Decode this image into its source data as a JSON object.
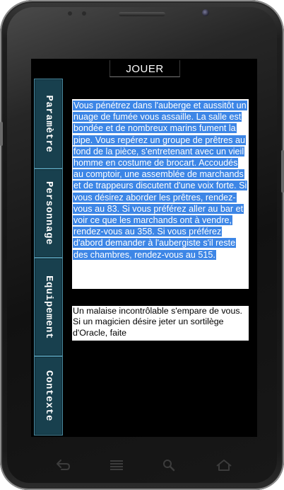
{
  "app": {
    "title": "JOUER"
  },
  "tabs": [
    {
      "label": "Paramètre"
    },
    {
      "label": "Personnage"
    },
    {
      "label": "Equipement"
    },
    {
      "label": "Contexte"
    }
  ],
  "story": {
    "text": "Vous pénétrez dans l'auberge et aussitôt un nuage de fumée vous assaille. La salle est bondée et de nombreux marins fument la pipe. Vous repérez un groupe de prêtres au fond de la pièce, s'entretenant avec un vieil homme en costume de brocart. Accoudés au comptoir, une assemblée de marchands et de trappeurs discutent d'une voix forte. Si vous désirez aborder les prêtres, rendez-vous au 83. Si vous préférez aller au bar et voir ce que les marchands ont à vendre, rendez-vous au 358. Si vous préférez d'abord demander à l'aubergiste s'il reste des chambres, rendez-vous au 515."
  },
  "aside": {
    "text": "Un malaise incontrôlable s'empare de vous. Si un magicien désire jeter un sortilège d'Oracle, faite"
  },
  "nav_keys": [
    {
      "icon": "back-icon"
    },
    {
      "icon": "menu-icon"
    },
    {
      "icon": "search-icon"
    },
    {
      "icon": "home-icon"
    }
  ],
  "colors": {
    "screen_bg": "#000000",
    "tab_bg": "#18404e",
    "tab_border": "#4a8aa0",
    "selection": "#3d86e6",
    "panel_bg": "#ffffff"
  }
}
